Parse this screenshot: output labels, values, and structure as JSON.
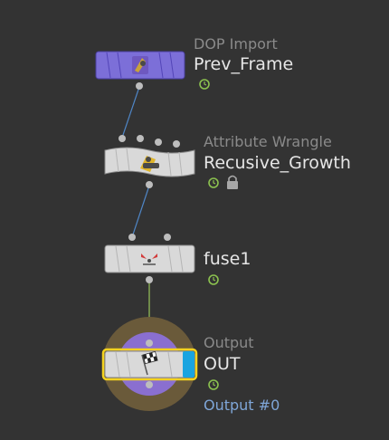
{
  "nodes": {
    "dop_import": {
      "type": "DOP Import",
      "name": "Prev_Frame",
      "icon": "dop-import-icon"
    },
    "attribute_wrangle": {
      "type": "Attribute Wrangle",
      "name": "Recusive_Growth",
      "icon": "wrangle-icon"
    },
    "fuse": {
      "type": "",
      "name": "fuse1",
      "icon": "fuse-icon"
    },
    "output": {
      "type": "Output",
      "name": "OUT",
      "icon": "checkered-flag-icon",
      "output_index": "Output #0"
    }
  },
  "colors": {
    "background": "#333333",
    "dop_node_fill": "#7c6fd8",
    "wire": "#4f86c6",
    "wire_output": "#9ac55a",
    "selection_outline": "#f4d21f",
    "display_flag": "#1aa4e0",
    "output_ring_outer": "#6a5a3a",
    "output_ring_inner": "#8a6fd0"
  }
}
